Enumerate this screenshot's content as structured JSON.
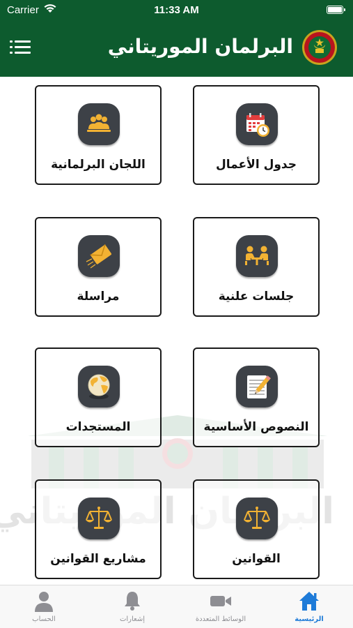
{
  "status_bar": {
    "carrier": "Carrier",
    "time": "11:33 AM"
  },
  "header": {
    "title": "البرلمان الموريتاني",
    "background_color": "#0d5b2e"
  },
  "watermark": {
    "text": "البرلمان الموريتاني"
  },
  "menu": {
    "tiles": [
      {
        "label": "جدول الأعمال",
        "icon": "calendar-clock-icon"
      },
      {
        "label": "اللجان البرلمانية",
        "icon": "people-group-icon"
      },
      {
        "label": "جلسات علنية",
        "icon": "meeting-table-icon"
      },
      {
        "label": "مراسلة",
        "icon": "envelope-icon"
      },
      {
        "label": "النصوص الأساسية",
        "icon": "notepad-pencil-icon"
      },
      {
        "label": "المستجدات",
        "icon": "globe-icon"
      },
      {
        "label": "القوانين",
        "icon": "scales-icon"
      },
      {
        "label": "مشاريع القوانين",
        "icon": "scales-icon"
      }
    ]
  },
  "tabbar": {
    "tabs": [
      {
        "label": "الرئيسية",
        "icon": "home-icon",
        "active": true
      },
      {
        "label": "الوسائط المتعددة",
        "icon": "video-camera-icon",
        "active": false
      },
      {
        "label": "إشعارات",
        "icon": "bell-icon",
        "active": false
      },
      {
        "label": "الحساب",
        "icon": "person-icon",
        "active": false
      }
    ],
    "active_color": "#1e7bd8",
    "inactive_color": "#8e8e93"
  }
}
